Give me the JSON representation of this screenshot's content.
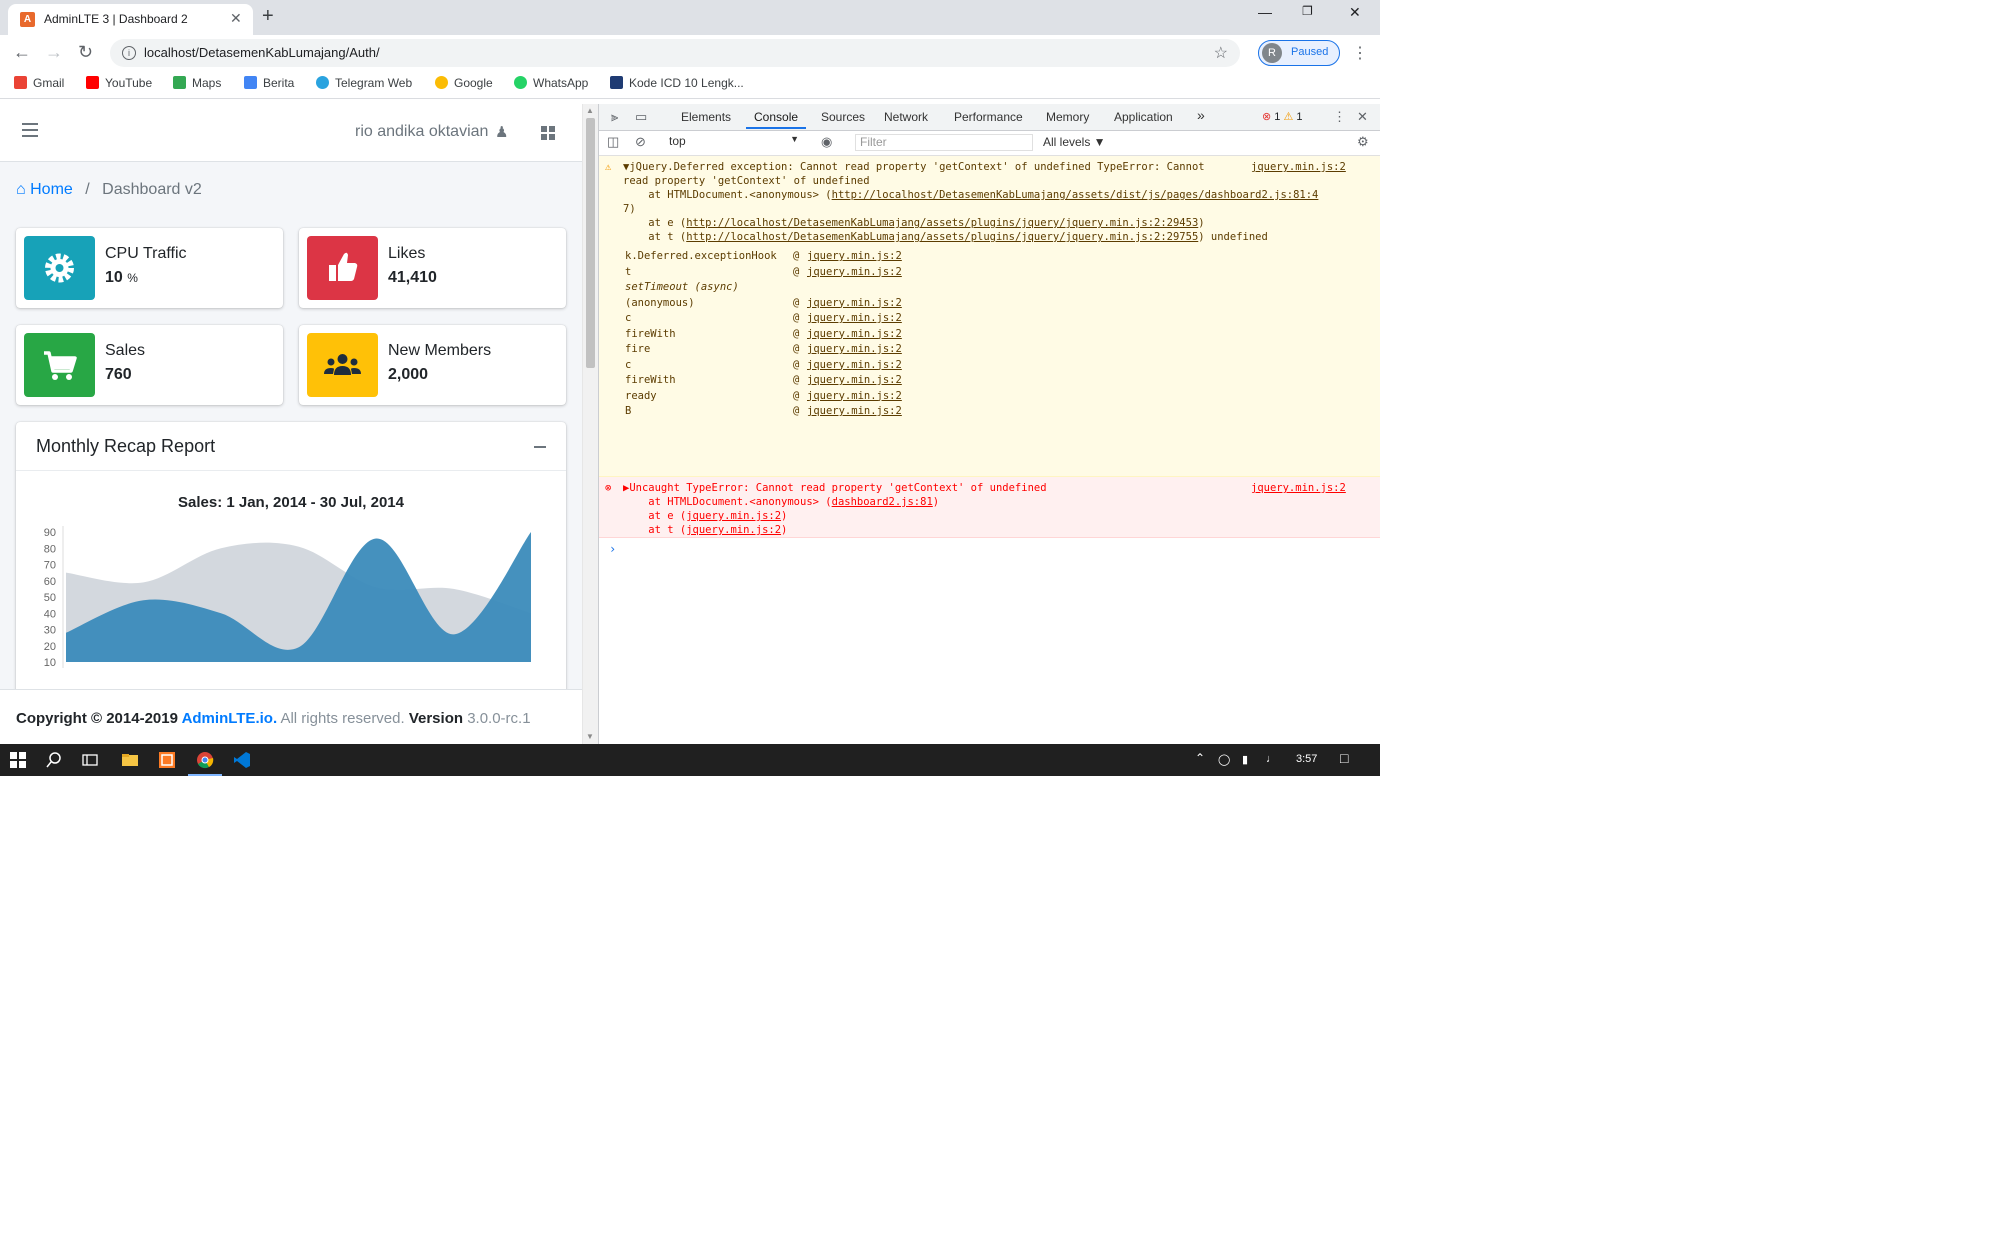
{
  "browser": {
    "tab_title": "AdminLTE 3 | Dashboard 2",
    "tab_close": "✕",
    "new_tab": "+",
    "url": "localhost/DetasemenKabLumajang/Auth/",
    "profile_initial": "R",
    "profile_status": "Paused",
    "bookmarks": [
      "Gmail",
      "YouTube",
      "Maps",
      "Berita",
      "Telegram Web",
      "Google",
      "WhatsApp",
      "Kode ICD 10 Lengk..."
    ]
  },
  "navbar": {
    "user_name": "rio andika oktavian"
  },
  "breadcrumb": {
    "home": "Home",
    "separator": "/",
    "current": "Dashboard v2"
  },
  "info_boxes": [
    {
      "label": "CPU Traffic",
      "value": "10",
      "unit": "%",
      "color": "#17a2b8",
      "icon": "gear-icon"
    },
    {
      "label": "Likes",
      "value": "41,410",
      "color": "#dc3545",
      "icon": "thumbs-up-icon"
    },
    {
      "label": "Sales",
      "value": "760",
      "color": "#28a745",
      "icon": "shopping-cart-icon"
    },
    {
      "label": "New Members",
      "value": "2,000",
      "color": "#ffc107",
      "icon": "users-icon"
    }
  ],
  "report_card": {
    "title": "Monthly Recap Report",
    "chart_title": "Sales: 1 Jan, 2014 - 30 Jul, 2014"
  },
  "chart_data": {
    "type": "area",
    "title": "Sales: 1 Jan, 2014 - 30 Jul, 2014",
    "xlabel": "",
    "ylabel": "",
    "yticks": [
      10,
      20,
      30,
      40,
      50,
      60,
      70,
      80,
      90
    ],
    "x": [
      0,
      1,
      2,
      3,
      4,
      5,
      6
    ],
    "series": [
      {
        "name": "",
        "values": [
          65,
          59,
          80,
          81,
          56,
          55,
          40
        ],
        "color": "#ced4da"
      },
      {
        "name": "",
        "values": [
          28,
          48,
          40,
          19,
          86,
          27,
          90
        ],
        "color": "#3b8bba"
      }
    ]
  },
  "footer": {
    "copyright": "Copyright © 2014-2019 ",
    "brand": "AdminLTE.io.",
    "rights": " All rights reserved. ",
    "version_label": "Version",
    "version": " 3.0.0-rc.1"
  },
  "devtools": {
    "tabs": [
      "Elements",
      "Console",
      "Sources",
      "Network",
      "Performance",
      "Memory",
      "Application"
    ],
    "more": "»",
    "error_count": "1",
    "warning_count": "1",
    "context": "top",
    "filter_placeholder": "Filter",
    "levels": "All levels ▼",
    "warning": {
      "line1": "▼jQuery.Deferred exception: Cannot read property 'getContext' of undefined TypeError: Cannot",
      "line2": "read property 'getContext' of undefined",
      "line3a": "    at HTMLDocument.<anonymous> (",
      "line3b": "http://localhost/DetasemenKabLumajang/assets/dist/js/pages/dashboard2.js:81:4",
      "line4": "7)",
      "line5a": "    at e (",
      "line5b": "http://localhost/DetasemenKabLumajang/assets/plugins/jquery/jquery.min.js:2:29453",
      "line5c": ")",
      "line6a": "    at t (",
      "line6b": "http://localhost/DetasemenKabLumajang/assets/plugins/jquery/jquery.min.js:2:29755",
      "line6c": ") undefined",
      "source": "jquery.min.js:2",
      "stack": [
        {
          "fn": "k.Deferred.exceptionHook",
          "src": "jquery.min.js:2"
        },
        {
          "fn": "t",
          "src": "jquery.min.js:2"
        },
        {
          "fn": "setTimeout (async)",
          "src": ""
        },
        {
          "fn": "(anonymous)",
          "src": "jquery.min.js:2"
        },
        {
          "fn": "c",
          "src": "jquery.min.js:2"
        },
        {
          "fn": "fireWith",
          "src": "jquery.min.js:2"
        },
        {
          "fn": "fire",
          "src": "jquery.min.js:2"
        },
        {
          "fn": "c",
          "src": "jquery.min.js:2"
        },
        {
          "fn": "fireWith",
          "src": "jquery.min.js:2"
        },
        {
          "fn": "ready",
          "src": "jquery.min.js:2"
        },
        {
          "fn": "B",
          "src": "jquery.min.js:2"
        }
      ]
    },
    "error": {
      "line1": "▶Uncaught TypeError: Cannot read property 'getContext' of undefined",
      "line2a": "    at HTMLDocument.<anonymous> (",
      "line2b": "dashboard2.js:81",
      "line2c": ")",
      "line3a": "    at e (",
      "line3b": "jquery.min.js:2",
      "line3c": ")",
      "line4a": "    at t (",
      "line4b": "jquery.min.js:2",
      "line4c": ")",
      "source": "jquery.min.js:2"
    }
  },
  "taskbar": {
    "time": "3:57"
  }
}
